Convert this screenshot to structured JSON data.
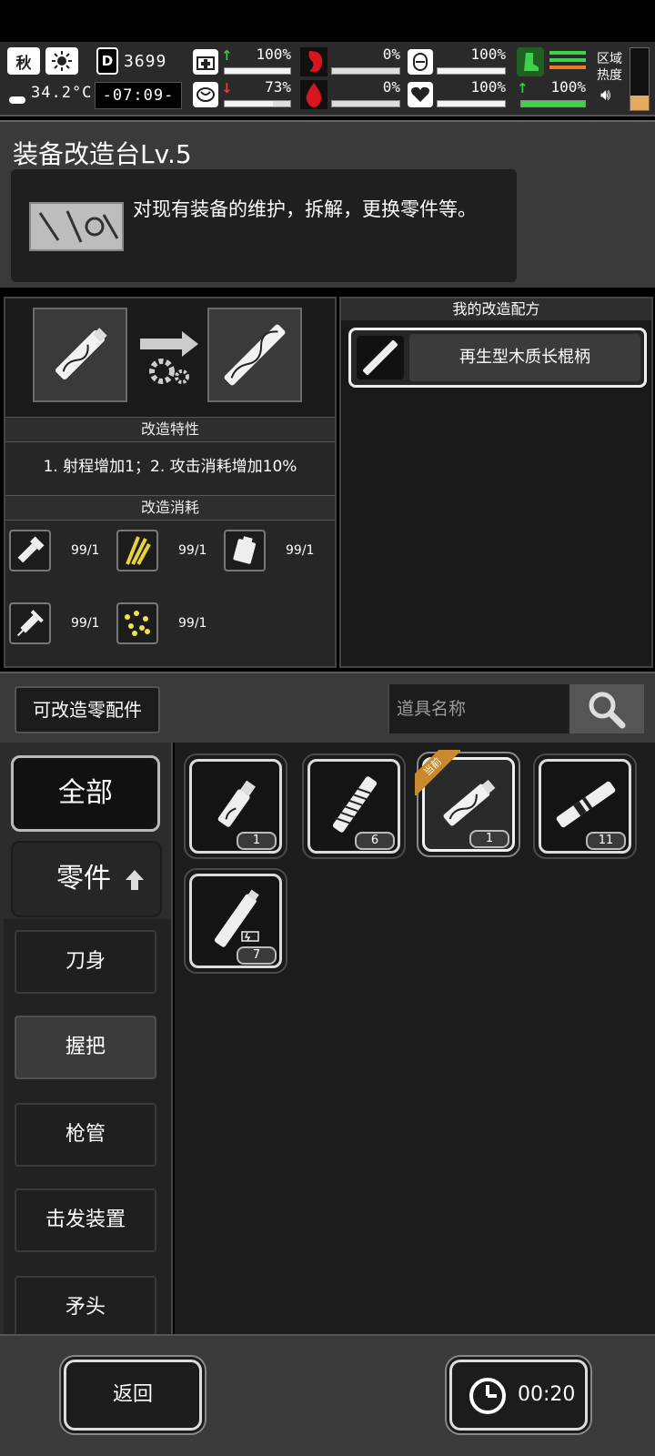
{
  "hud": {
    "season": "秋",
    "weather_icon": "sun-icon",
    "day_label": "D",
    "day_value": "3699",
    "temperature": "34.2°C",
    "clock": "-07:09-",
    "health_pct": "100%",
    "mood_pct": "73%",
    "hunger_pct": "0%",
    "thirst_pct": "0%",
    "armor_pct": "100%",
    "heart_pct": "100%",
    "stamina_pct": "100%",
    "zone_label_1": "区域",
    "zone_label_2": "热度",
    "levels": {
      "health": 1.0,
      "mood": 0.73,
      "hunger": 0.0,
      "thirst": 0.0,
      "armor": 1.0,
      "heart": 1.0,
      "stamina": 1.0
    }
  },
  "header": {
    "title": "装备改造台Lv.5",
    "description": "对现有装备的维护，拆解，更换零件等。"
  },
  "mod": {
    "traits_heading": "改造特性",
    "traits_text": "1. 射程增加1；2. 攻击消耗增加10%",
    "cost_heading": "改造消耗",
    "costs": [
      {
        "icon": "flashlight-icon",
        "amount": "99/1"
      },
      {
        "icon": "wheat-icon",
        "amount": "99/1"
      },
      {
        "icon": "battery-icon",
        "amount": "99/1"
      },
      {
        "icon": "syringe-icon",
        "amount": "99/1"
      },
      {
        "icon": "grains-icon",
        "amount": "99/1"
      }
    ]
  },
  "recipes": {
    "heading": "我的改造配方",
    "items": [
      {
        "label": "再生型木质长棍柄"
      }
    ]
  },
  "parts": {
    "button_label": "可改造零配件",
    "search_placeholder": "道具名称"
  },
  "categories": {
    "all": "全部",
    "parts": "零件",
    "items": [
      "刀身",
      "握把",
      "枪管",
      "击发装置",
      "矛头"
    ]
  },
  "grid": {
    "current_badge": "当前",
    "items": [
      {
        "count": "1"
      },
      {
        "count": "6"
      },
      {
        "count": "1"
      },
      {
        "count": "11"
      },
      {
        "count": "7"
      }
    ]
  },
  "footer": {
    "back_label": "返回",
    "timer": "00:20"
  },
  "colors": {
    "panel": "#3a3a3a",
    "dark": "#1c1c1c",
    "badge": "#c98a2e",
    "up": "#2ecc40",
    "down": "#ff3030",
    "blood": "#d9161e"
  }
}
